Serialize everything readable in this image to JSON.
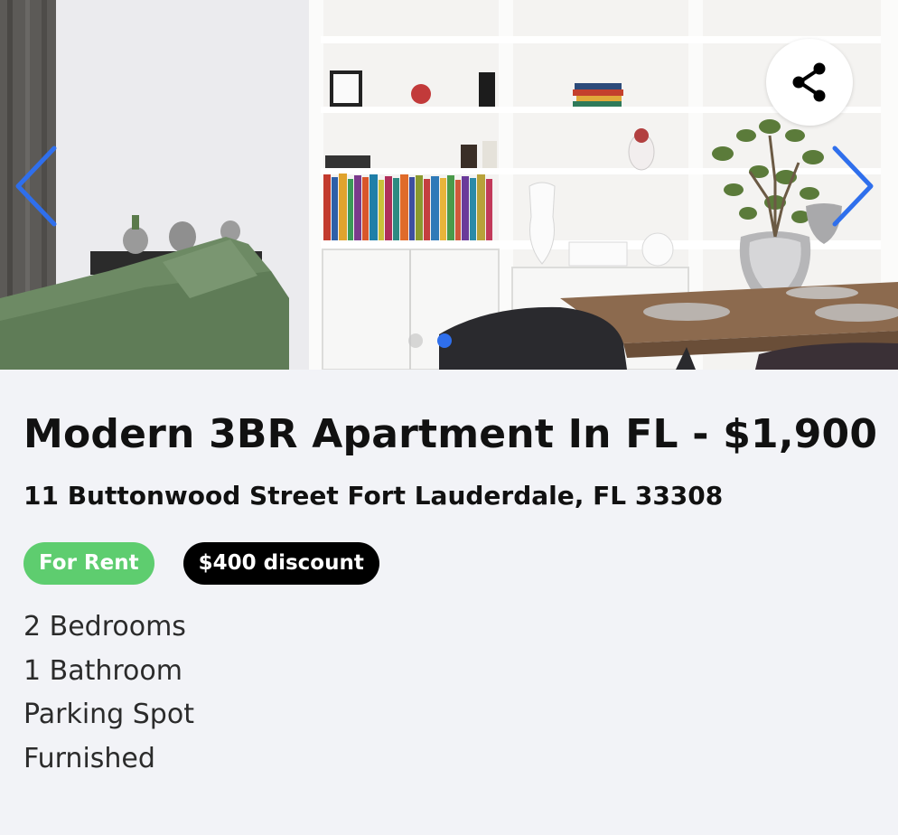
{
  "listing": {
    "title": "Modern 3BR Apartment In FL - $1,900",
    "address": "11 Buttonwood Street Fort Lauderdale, FL 33308",
    "status_badge": "For Rent",
    "discount_badge": "$400 discount",
    "features": [
      "2 Bedrooms",
      "1 Bathroom",
      "Parking Spot",
      "Furnished"
    ]
  },
  "gallery": {
    "photo_subject": "Furnished living room with white bookshelves, green sofa and dining table",
    "prev_icon": "chevron-left-icon",
    "next_icon": "chevron-right-icon",
    "share_icon": "share-icon",
    "slide_count": 2,
    "active_slide": 2
  },
  "colors": {
    "accent": "#2f6fec",
    "for_rent_badge": "#5ecd6f",
    "discount_badge": "#000000",
    "background": "#f2f3f7",
    "text": "#111111"
  }
}
